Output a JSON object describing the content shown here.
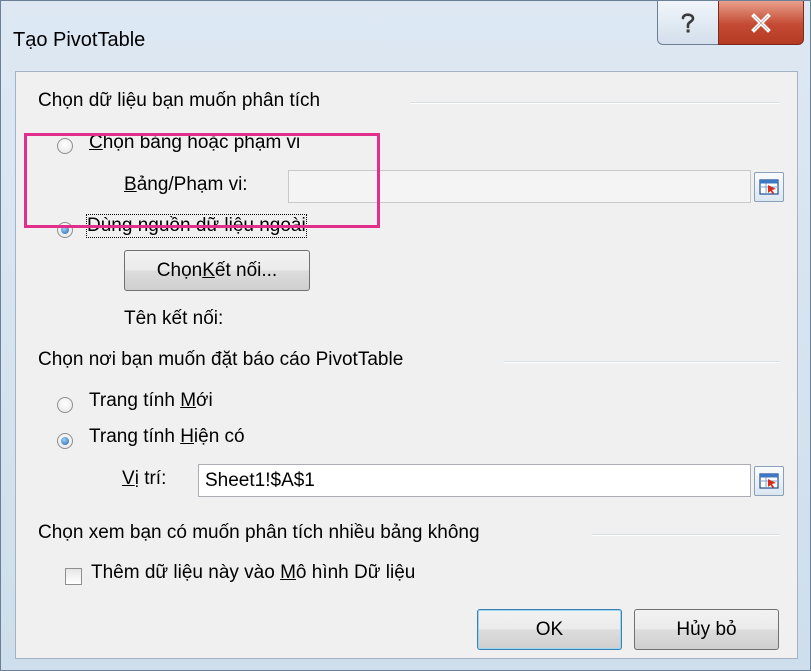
{
  "window": {
    "title": "Tạo PivotTable",
    "help_icon": "help-icon",
    "close_icon": "close-icon"
  },
  "section1": {
    "label": "Chọn dữ liệu bạn muốn phân tích",
    "option1": {
      "prefix": "",
      "accel": "C",
      "rest": "họn bảng hoặc phạm vi",
      "selected": false
    },
    "range": {
      "accel": "B",
      "rest": "ảng/Phạm vi:",
      "value": ""
    },
    "option2": {
      "label": "Dùng nguồn dữ liệu ngoài",
      "selected": true
    },
    "choose_conn": {
      "prefix": "Chọn ",
      "accel": "K",
      "rest": "ết nối..."
    },
    "conn_name_label": "Tên kết nối:"
  },
  "section2": {
    "label": "Chọn nơi bạn muốn đặt báo cáo PivotTable",
    "option1": {
      "prefix": "Trang tính ",
      "accel": "M",
      "rest": "ới",
      "selected": false
    },
    "option2": {
      "prefix": "Trang tính ",
      "accel": "H",
      "rest": "iện có",
      "selected": true
    },
    "location": {
      "accel": "V",
      "rest": "ị trí:",
      "value": "Sheet1!$A$1"
    }
  },
  "section3": {
    "label": "Chọn xem bạn có muốn phân tích nhiều bảng không",
    "checkbox": {
      "prefix": "Thêm dữ liệu này vào ",
      "accel": "M",
      "rest": "ô hình Dữ liệu",
      "checked": false
    }
  },
  "buttons": {
    "ok": "OK",
    "cancel": "Hủy bỏ"
  },
  "colors": {
    "highlight": "#e22f8c",
    "close_button": "#c44a33"
  }
}
